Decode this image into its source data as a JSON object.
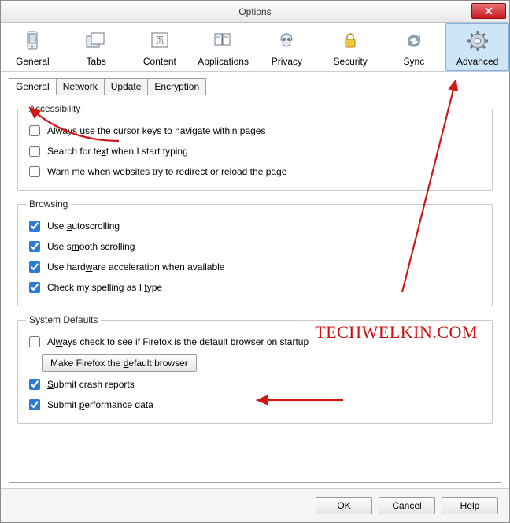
{
  "window": {
    "title": "Options"
  },
  "toolbar": {
    "items": [
      {
        "label": "General"
      },
      {
        "label": "Tabs"
      },
      {
        "label": "Content"
      },
      {
        "label": "Applications"
      },
      {
        "label": "Privacy"
      },
      {
        "label": "Security"
      },
      {
        "label": "Sync"
      },
      {
        "label": "Advanced"
      }
    ],
    "selected_index": 7
  },
  "tabs": {
    "items": [
      {
        "label": "General"
      },
      {
        "label": "Network"
      },
      {
        "label": "Update"
      },
      {
        "label": "Encryption"
      }
    ],
    "active_index": 0
  },
  "groups": {
    "accessibility": {
      "legend": "Accessibility",
      "options": [
        {
          "label_pre": "Always use the ",
          "accel": "c",
          "label_post": "ursor keys to navigate within pages",
          "checked": false
        },
        {
          "label_pre": "Search for te",
          "accel": "x",
          "label_post": "t when I start typing",
          "checked": false
        },
        {
          "label_pre": "Warn me when we",
          "accel": "b",
          "label_post": "sites try to redirect or reload the page",
          "checked": false
        }
      ]
    },
    "browsing": {
      "legend": "Browsing",
      "options": [
        {
          "label_pre": "Use ",
          "accel": "a",
          "label_post": "utoscrolling",
          "checked": true
        },
        {
          "label_pre": "Use s",
          "accel": "m",
          "label_post": "ooth scrolling",
          "checked": true
        },
        {
          "label_pre": "Use hard",
          "accel": "w",
          "label_post": "are acceleration when available",
          "checked": true
        },
        {
          "label_pre": "Check my spelling as I ",
          "accel": "t",
          "label_post": "ype",
          "checked": true
        }
      ]
    },
    "system": {
      "legend": "System Defaults",
      "check_default": {
        "label_pre": "Al",
        "accel": "w",
        "label_post": "ays check to see if Firefox is the default browser on startup",
        "checked": false
      },
      "button_pre": "Make Firefox the ",
      "button_accel": "d",
      "button_post": "efault browser",
      "crash": {
        "label_pre": "",
        "accel": "S",
        "label_post": "ubmit crash reports",
        "checked": true
      },
      "perf": {
        "label_pre": "Submit ",
        "accel": "p",
        "label_post": "erformance data",
        "checked": true
      }
    }
  },
  "buttons": {
    "ok": "OK",
    "cancel": "Cancel",
    "help_pre": "",
    "help_accel": "H",
    "help_post": "elp"
  },
  "watermark": "TECHWELKIN.COM"
}
